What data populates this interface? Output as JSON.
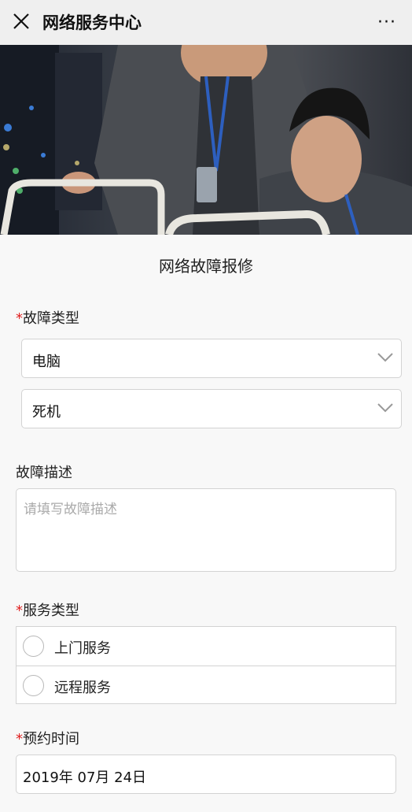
{
  "header": {
    "title": "网络服务中心",
    "close_icon": "close-icon",
    "more_icon": "more-icon",
    "more_glyph": "···"
  },
  "hero": {
    "image": "two-technicians-in-server-room"
  },
  "form": {
    "title": "网络故障报修",
    "required_mark": "*",
    "fault_type": {
      "label": "故障类型",
      "device_value": "电脑",
      "symptom_value": "死机"
    },
    "description": {
      "label": "故障描述",
      "placeholder": "请填写故障描述"
    },
    "service_type": {
      "label": "服务类型",
      "options": [
        "上门服务",
        "远程服务"
      ]
    },
    "appointment": {
      "label": "预约时间",
      "value": "2019年 07月 24日"
    }
  },
  "colors": {
    "required": "#e02020",
    "nav_bg": "#efefef",
    "border": "#d3d3d3"
  }
}
